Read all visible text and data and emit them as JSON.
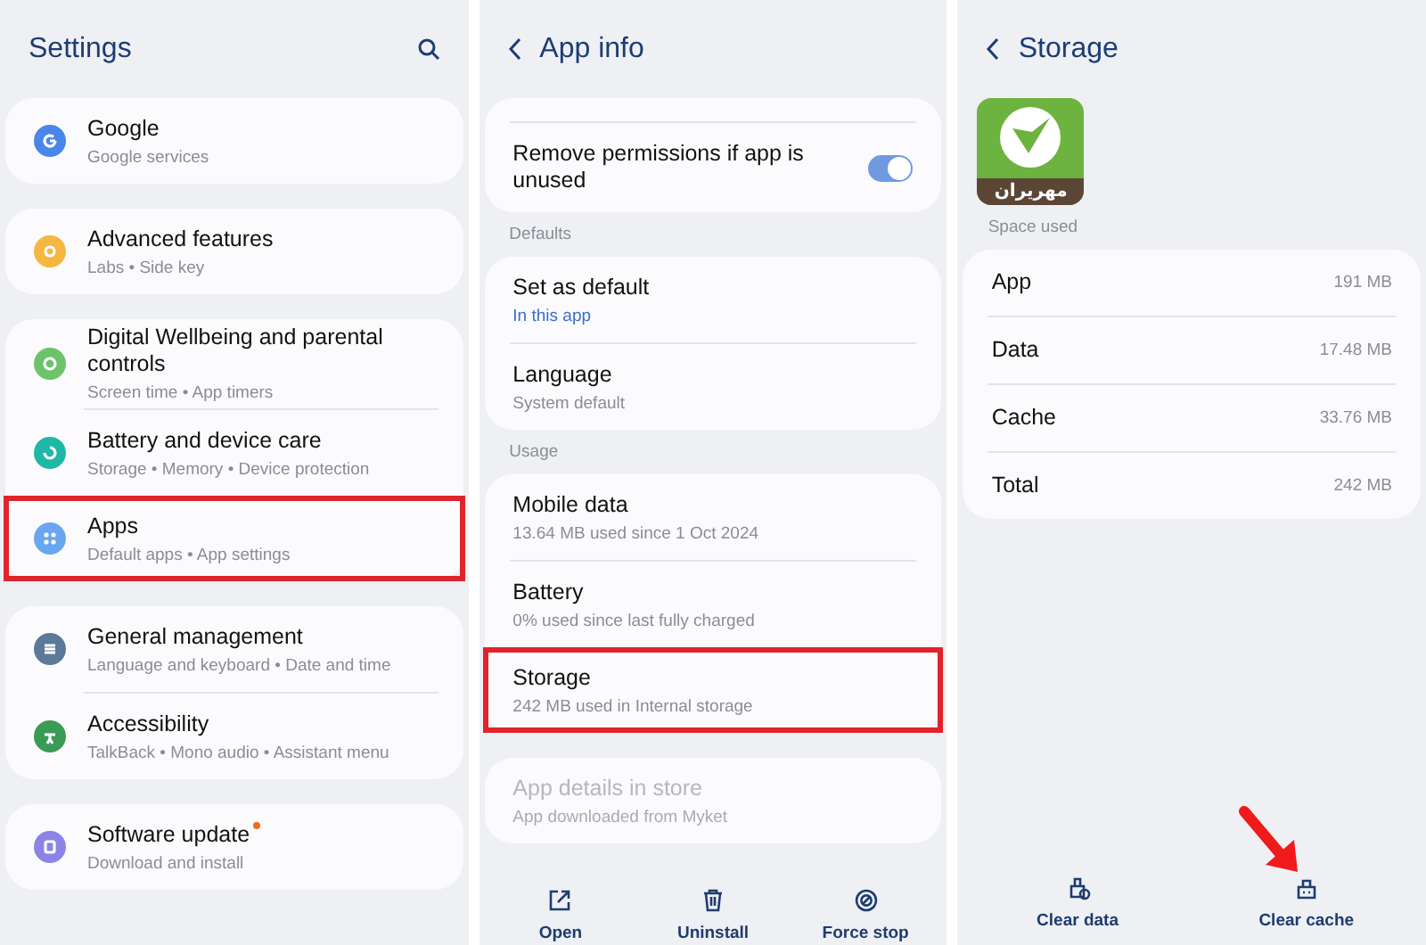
{
  "settings": {
    "title": "Settings",
    "groups": [
      {
        "items": [
          {
            "title": "Google",
            "subtitle": "Google services",
            "color": "#4a86e8",
            "highlighted": false,
            "notification": false
          }
        ]
      },
      {
        "items": [
          {
            "title": "Advanced features",
            "subtitle": "Labs • Side key",
            "color": "#f4b740",
            "highlighted": false,
            "notification": false
          }
        ]
      },
      {
        "items": [
          {
            "title": "Digital Wellbeing and parental controls",
            "subtitle": "Screen time • App timers",
            "color": "#6cc36c",
            "highlighted": false,
            "notification": false
          },
          {
            "title": "Battery and device care",
            "subtitle": "Storage • Memory • Device protection",
            "color": "#1fb8a6",
            "highlighted": false,
            "notification": false
          },
          {
            "title": "Apps",
            "subtitle": "Default apps • App settings",
            "color": "#6aa6f0",
            "highlighted": true,
            "notification": false
          }
        ]
      },
      {
        "items": [
          {
            "title": "General management",
            "subtitle": "Language and keyboard • Date and time",
            "color": "#5b7a99",
            "highlighted": false,
            "notification": false
          },
          {
            "title": "Accessibility",
            "subtitle": "TalkBack • Mono audio • Assistant menu",
            "color": "#3a9b57",
            "highlighted": false,
            "notification": false
          }
        ]
      },
      {
        "items": [
          {
            "title": "Software update",
            "subtitle": "Download and install",
            "color": "#8c83e6",
            "highlighted": false,
            "notification": true
          }
        ]
      }
    ]
  },
  "app_info": {
    "title": "App info",
    "sections": [
      {
        "items": [
          {
            "kind": "toggle",
            "title": "Remove permissions if app is unused",
            "on": true
          }
        ]
      },
      {
        "label": "Defaults",
        "items": [
          {
            "kind": "link",
            "title": "Set as default",
            "subtitle": "In this app",
            "highlighted": false,
            "disabled": false
          },
          {
            "kind": "plain",
            "title": "Language",
            "subtitle": "System default",
            "highlighted": false,
            "disabled": false
          }
        ]
      },
      {
        "label": "Usage",
        "items": [
          {
            "kind": "plain",
            "title": "Mobile data",
            "subtitle": "13.64 MB used since 1 Oct 2024",
            "highlighted": false,
            "disabled": false
          },
          {
            "kind": "plain",
            "title": "Battery",
            "subtitle": "0% used since last fully charged",
            "highlighted": false,
            "disabled": false
          },
          {
            "kind": "plain",
            "title": "Storage",
            "subtitle": "242 MB used in Internal storage",
            "highlighted": true,
            "disabled": false
          }
        ]
      },
      {
        "items": [
          {
            "kind": "plain",
            "title": "App details in store",
            "subtitle": "App downloaded from Myket",
            "highlighted": false,
            "disabled": true
          }
        ]
      }
    ],
    "actions": [
      {
        "label": "Open"
      },
      {
        "label": "Uninstall"
      },
      {
        "label": "Force stop"
      }
    ]
  },
  "storage": {
    "title": "Storage",
    "app_logo_text": "مهریران",
    "section_label": "Space used",
    "rows": [
      {
        "label": "App",
        "value": "191 MB"
      },
      {
        "label": "Data",
        "value": "17.48 MB"
      },
      {
        "label": "Cache",
        "value": "33.76 MB"
      },
      {
        "label": "Total",
        "value": "242 MB"
      }
    ],
    "actions": [
      {
        "label": "Clear data",
        "pointed": false
      },
      {
        "label": "Clear cache",
        "pointed": true
      }
    ]
  }
}
